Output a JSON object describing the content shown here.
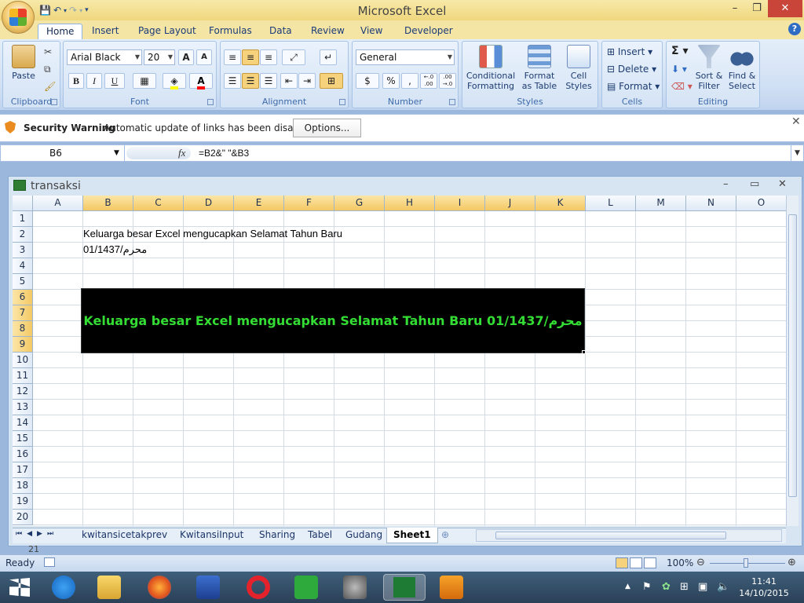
{
  "app": {
    "title": "Microsoft Excel",
    "window_controls": {
      "minimize": "–",
      "restore": "❐",
      "close": "✕"
    }
  },
  "ribbon": {
    "tabs": [
      "Home",
      "Insert",
      "Page Layout",
      "Formulas",
      "Data",
      "Review",
      "View",
      "Developer"
    ],
    "active_tab": "Home",
    "groups": {
      "clipboard": {
        "label": "Clipboard",
        "paste": "Paste"
      },
      "font": {
        "label": "Font",
        "font_name": "Arial Black",
        "font_size": "20",
        "bold": "B",
        "italic": "I",
        "underline": "U",
        "grow": "A",
        "shrink": "A",
        "fill_color": "#ffff00",
        "font_color": "#ff0000"
      },
      "alignment": {
        "label": "Alignment"
      },
      "number": {
        "label": "Number",
        "format": "General",
        "percent": "%",
        "comma": ",",
        "increase_decimal": "←.0\n.00",
        "decrease_decimal": ".00\n→.0"
      },
      "styles": {
        "label": "Styles",
        "conditional": "Conditional",
        "conditional2": "Formatting",
        "format_table": "Format",
        "format_table2": "as Table",
        "cell_styles": "Cell",
        "cell_styles2": "Styles"
      },
      "cells": {
        "label": "Cells",
        "insert": "Insert",
        "delete": "Delete",
        "format": "Format"
      },
      "editing": {
        "label": "Editing",
        "sort": "Sort &",
        "sort2": "Filter",
        "find": "Find &",
        "find2": "Select",
        "sigma": "Σ"
      }
    }
  },
  "security": {
    "title": "Security Warning",
    "message": "Automatic update of links has been disabled",
    "button": "Options..."
  },
  "formula_bar": {
    "name_box": "B6",
    "fx": "fx",
    "formula": "=B2&\" \"&B3"
  },
  "workbook": {
    "name": "transaksi",
    "columns": [
      "A",
      "B",
      "C",
      "D",
      "E",
      "F",
      "G",
      "H",
      "I",
      "J",
      "K",
      "L",
      "M",
      "N",
      "O"
    ],
    "selected_columns": [
      "B",
      "C",
      "D",
      "E",
      "F",
      "G",
      "H",
      "I",
      "J",
      "K"
    ],
    "rows": [
      "1",
      "2",
      "3",
      "4",
      "5",
      "6",
      "7",
      "8",
      "9",
      "10",
      "11",
      "12",
      "13",
      "14",
      "15",
      "16",
      "17",
      "18",
      "19",
      "20"
    ],
    "selected_rows": [
      "6",
      "7",
      "8",
      "9"
    ],
    "cells": {
      "B2": "Keluarga besar Excel mengucapkan Selamat Tahun Baru",
      "B3": "01/1437/محرم",
      "B6": "Keluarga besar Excel mengucapkan Selamat Tahun Baru 01/1437/محرم"
    },
    "merged_cell_style": {
      "background": "#000000",
      "text_color": "#33dd33"
    },
    "partial_row": "21"
  },
  "sheet_tabs": [
    "kwitansicetakprev",
    "KwitansiInput",
    "Sharing",
    "Tabel",
    "Gudang",
    "Sheet1"
  ],
  "active_sheet": "Sheet1",
  "status": {
    "mode": "Ready",
    "zoom": "100%"
  },
  "taskbar": {
    "time": "11:41",
    "date": "14/10/2015"
  }
}
